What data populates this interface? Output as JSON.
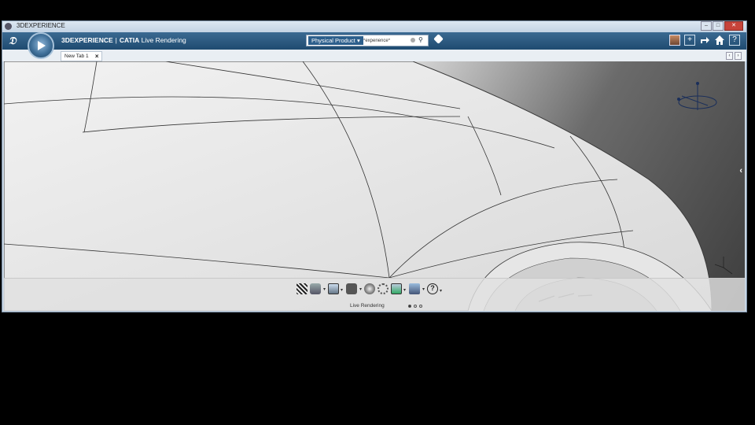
{
  "os_window": {
    "title": "3DEXPERIENCE",
    "controls": [
      "–",
      "□",
      "✕"
    ]
  },
  "app": {
    "brand": "3DEXPERIENCE",
    "separator": "|",
    "product": "CATIA",
    "module": "Live Rendering"
  },
  "search": {
    "scope": "Physical Product",
    "value": "*experience*"
  },
  "topright_icons": [
    "avatar",
    "plus-icon",
    "share-icon",
    "home-icon",
    "help-icon"
  ],
  "help_glyph": "?",
  "plus_glyph": "+",
  "tab": {
    "label": "New Tab 1",
    "close": "×"
  },
  "toolbar": {
    "label": "Live Rendering",
    "tools": [
      "clapperboard-icon",
      "material-icon",
      "environment-icon",
      "camera-icon",
      "render-icon",
      "settings-icon",
      "document-icon",
      "options-icon",
      "help-icon"
    ],
    "help_glyph": "?"
  },
  "colors": {
    "appbar": "#1f4b70",
    "scope_accent": "#2d5f8c",
    "close": "#c7443a"
  }
}
